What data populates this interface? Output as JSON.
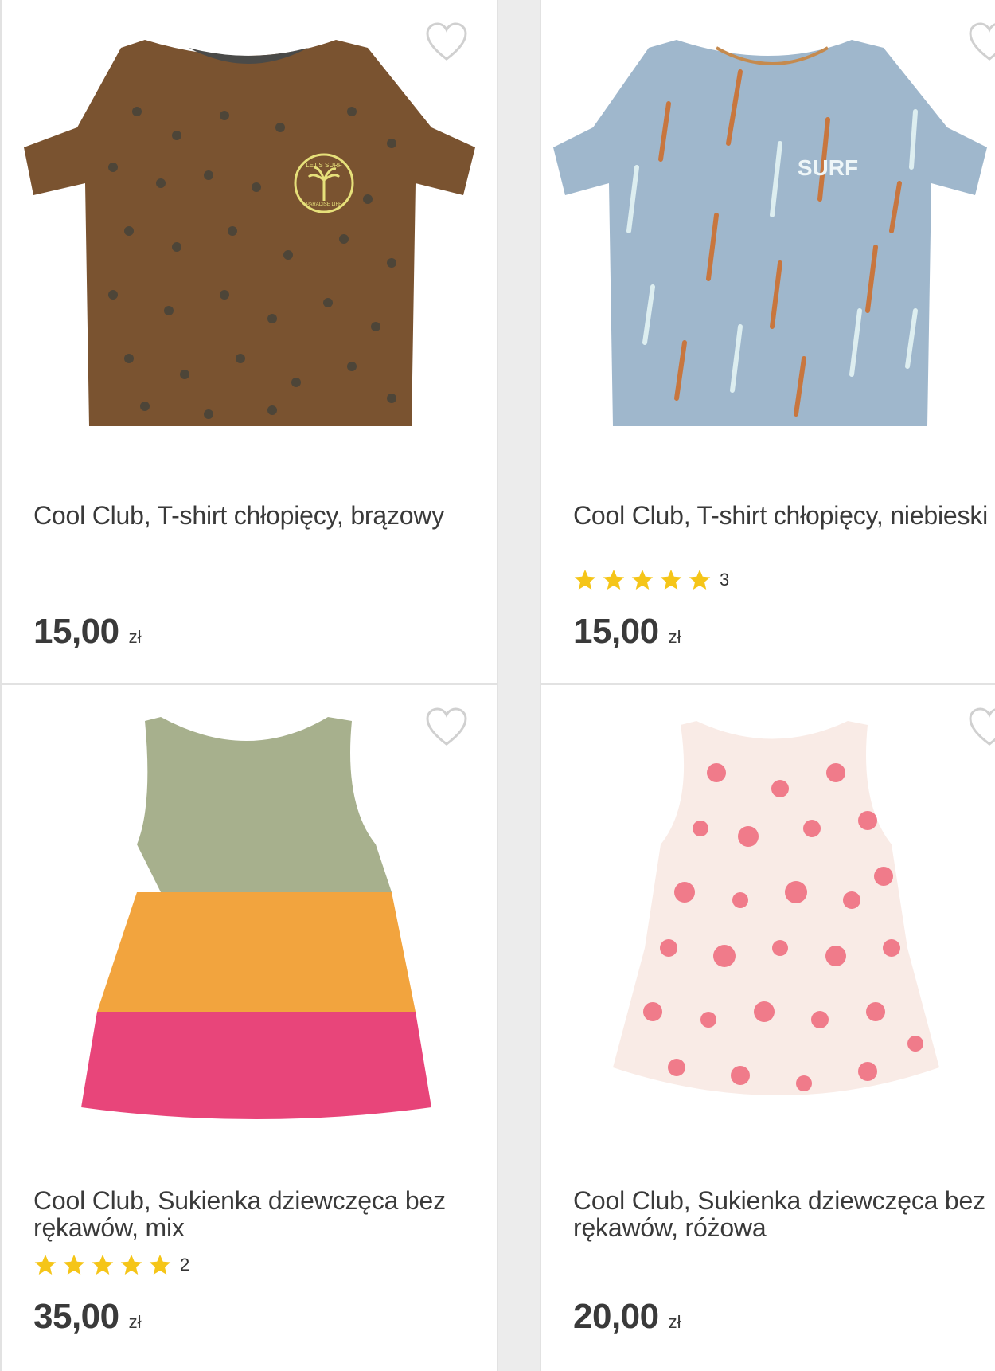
{
  "colors": {
    "star": "#f5c518",
    "heart_outline": "#d0d0d0",
    "text": "#3a3a3a",
    "card_border": "#e2e2e2"
  },
  "products": [
    {
      "name": "Cool Club, T-shirt chłopięcy, brązowy",
      "price": "15,00",
      "currency": "zł",
      "image_icon": "brown-palm-tshirt",
      "image_text": "LET'S SURF",
      "image_text2": "PARADISE LIFE"
    },
    {
      "name": "Cool Club, T-shirt chłopięcy, niebieski",
      "rating_stars": 5,
      "rating_count": "3",
      "price": "15,00",
      "currency": "zł",
      "image_icon": "blue-palm-tshirt",
      "image_text": "SURF"
    },
    {
      "name": "Cool Club, Sukienka dziewczęca bez rękawów, mix",
      "rating_stars": 5,
      "rating_count": "2",
      "price": "35,00",
      "currency": "zł",
      "image_icon": "tiered-colorblock-dress"
    },
    {
      "name": "Cool Club, Sukienka dziewczęca bez rękawów, różowa",
      "price": "20,00",
      "currency": "zł",
      "image_icon": "polka-dot-dress"
    }
  ]
}
